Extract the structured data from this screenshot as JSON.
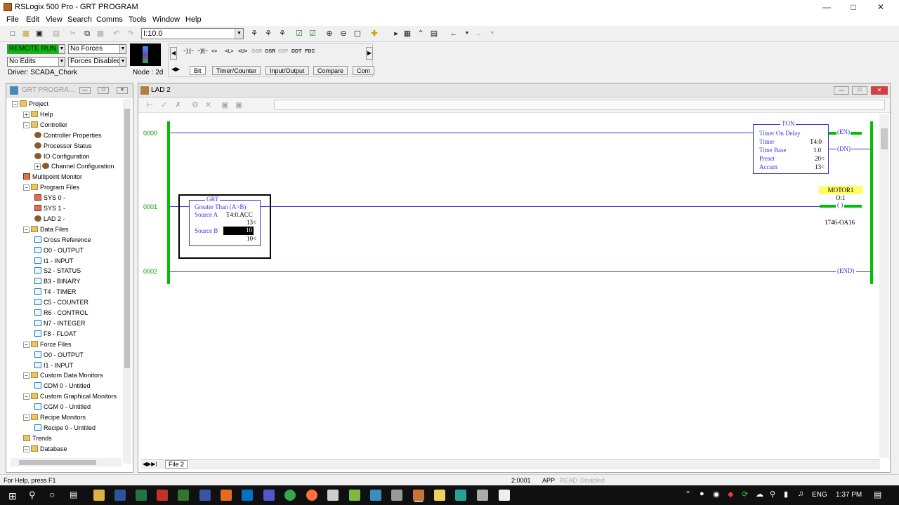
{
  "window": {
    "title": "RSLogix 500 Pro - GRT PROGRAM"
  },
  "menu": [
    "File",
    "Edit",
    "View",
    "Search",
    "Comms",
    "Tools",
    "Window",
    "Help"
  ],
  "toolbar": {
    "address": "I:10.0"
  },
  "status": {
    "mode": "REMOTE RUN",
    "forces": "No Forces",
    "edits": "No Edits",
    "forces_enabled": "Forces Disabled",
    "driver": "Driver: SCADA_Chork",
    "node": "Node :  2d"
  },
  "palette": {
    "instructions": [
      "−] [−",
      "−]/[−",
      "<>",
      "<L>",
      "<U>",
      "OSR",
      "OSR",
      "OSF",
      "DDT",
      "FBC"
    ],
    "tabs": [
      "Bit",
      "Timer/Counter",
      "Input/Output",
      "Compare",
      "Com"
    ]
  },
  "project": {
    "title": "GRT PROGRA...",
    "items": [
      "Project",
      "Help",
      "Controller",
      "Controller Properties",
      "Processor Status",
      "IO Configuration",
      "Channel Configuration",
      "Multipoint Monitor",
      "Program Files",
      "SYS 0 -",
      "SYS 1 -",
      "LAD 2 -",
      "Data Files",
      "Cross Reference",
      "O0 - OUTPUT",
      "I1 - INPUT",
      "S2 - STATUS",
      "B3 - BINARY",
      "T4 - TIMER",
      "C5 - COUNTER",
      "R6 - CONTROL",
      "N7 - INTEGER",
      "F8 - FLOAT",
      "Force Files",
      "O0 - OUTPUT",
      "I1 - INPUT",
      "Custom Data Monitors",
      "CDM 0 - Untitled",
      "Custom Graphical Monitors",
      "CGM 0 - Untitled",
      "Recipe Monitors",
      "Recipe 0 - Untitled",
      "Trends",
      "Database"
    ]
  },
  "ladder": {
    "title": "LAD 2",
    "rungs": [
      "0000",
      "0001",
      "0002"
    ],
    "ton": {
      "name": "TON",
      "desc": "Timer On Delay",
      "rows": [
        [
          "Timer",
          "T4:0"
        ],
        [
          "Time Base",
          "1.0"
        ],
        [
          "Preset",
          "20<"
        ],
        [
          "Accum",
          "13<"
        ]
      ],
      "en": "EN",
      "dn": "DN"
    },
    "grt": {
      "name": "GRT",
      "desc": "Greater Than (A>B)",
      "source_a_label": "Source A",
      "source_a": "T4:0.ACC",
      "source_a_val": "13<",
      "source_b_label": "Source B",
      "source_b": "10",
      "source_b_val": "10<"
    },
    "motor": {
      "tag": "MOTOR1",
      "addr": "O:1",
      "module": "1746-OA16"
    },
    "end": "END",
    "file_tab": "File 2"
  },
  "statusbar": {
    "help": "For Help, press F1",
    "pos": "2:0001",
    "app": "APP",
    "read": "READ",
    "disabled": "Disabled"
  },
  "taskbar": {
    "lang": "ENG",
    "time": "1:37 PM"
  }
}
